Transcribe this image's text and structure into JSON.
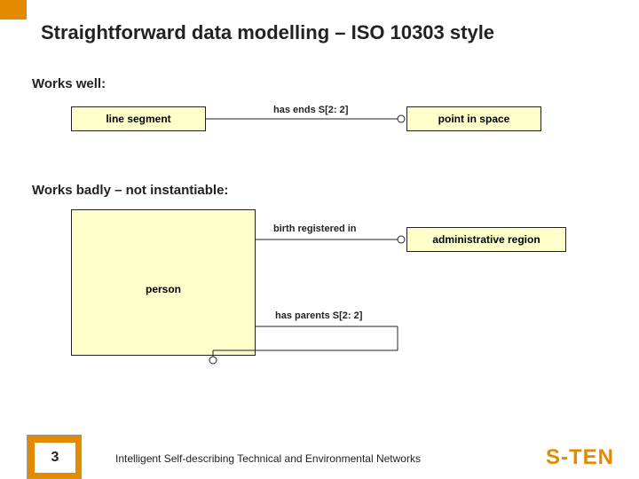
{
  "title": "Straightforward data modelling – ISO 10303 style",
  "sections": {
    "works_well": "Works well:",
    "works_badly": "Works badly – not instantiable:"
  },
  "entities": {
    "line_segment": "line segment",
    "point_in_space": "point in space",
    "person": "person",
    "admin_region": "administrative region"
  },
  "relations": {
    "has_ends": "has ends S[2: 2]",
    "birth_registered": "birth registered in",
    "has_parents": "has parents S[2: 2]"
  },
  "footer": {
    "slide_number": "3",
    "caption": "Intelligent Self-describing Technical and Environmental Networks",
    "brand": "S-TEN"
  },
  "colors": {
    "accent": "#E48A00",
    "entity_fill": "#FFFFCC"
  }
}
